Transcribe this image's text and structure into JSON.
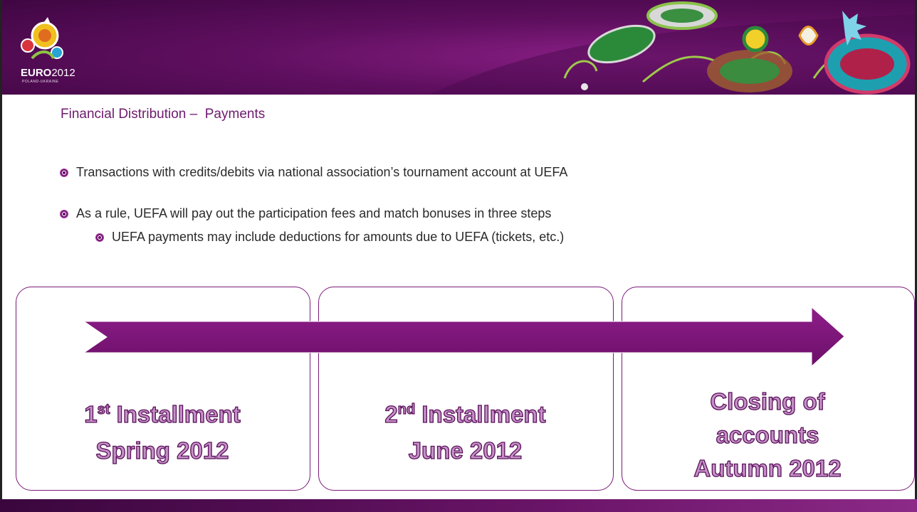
{
  "logo": {
    "brand": "EURO",
    "year": "2012",
    "subtitle": "POLAND-UKRAINE"
  },
  "title": "Financial Distribution –  Payments",
  "bullets": [
    "Transactions with credits/debits via national association’s tournament account at UEFA",
    "As a rule, UEFA will pay out the participation fees and match bonuses in three steps",
    "UEFA payments may include deductions for amounts due to UEFA (tickets, etc.)"
  ],
  "steps": [
    {
      "num": "1",
      "suffix": "st",
      "label": "Installment",
      "date": "Spring 2012"
    },
    {
      "num": "2",
      "suffix": "nd",
      "label": "Installment",
      "date": "June 2012"
    },
    {
      "line1": "Closing of",
      "line2": "accounts",
      "date": "Autumn 2012"
    }
  ],
  "colors": {
    "brand_purple": "#6e1a6e",
    "arrow": "#7c1479",
    "step_text": "#c491c6"
  }
}
